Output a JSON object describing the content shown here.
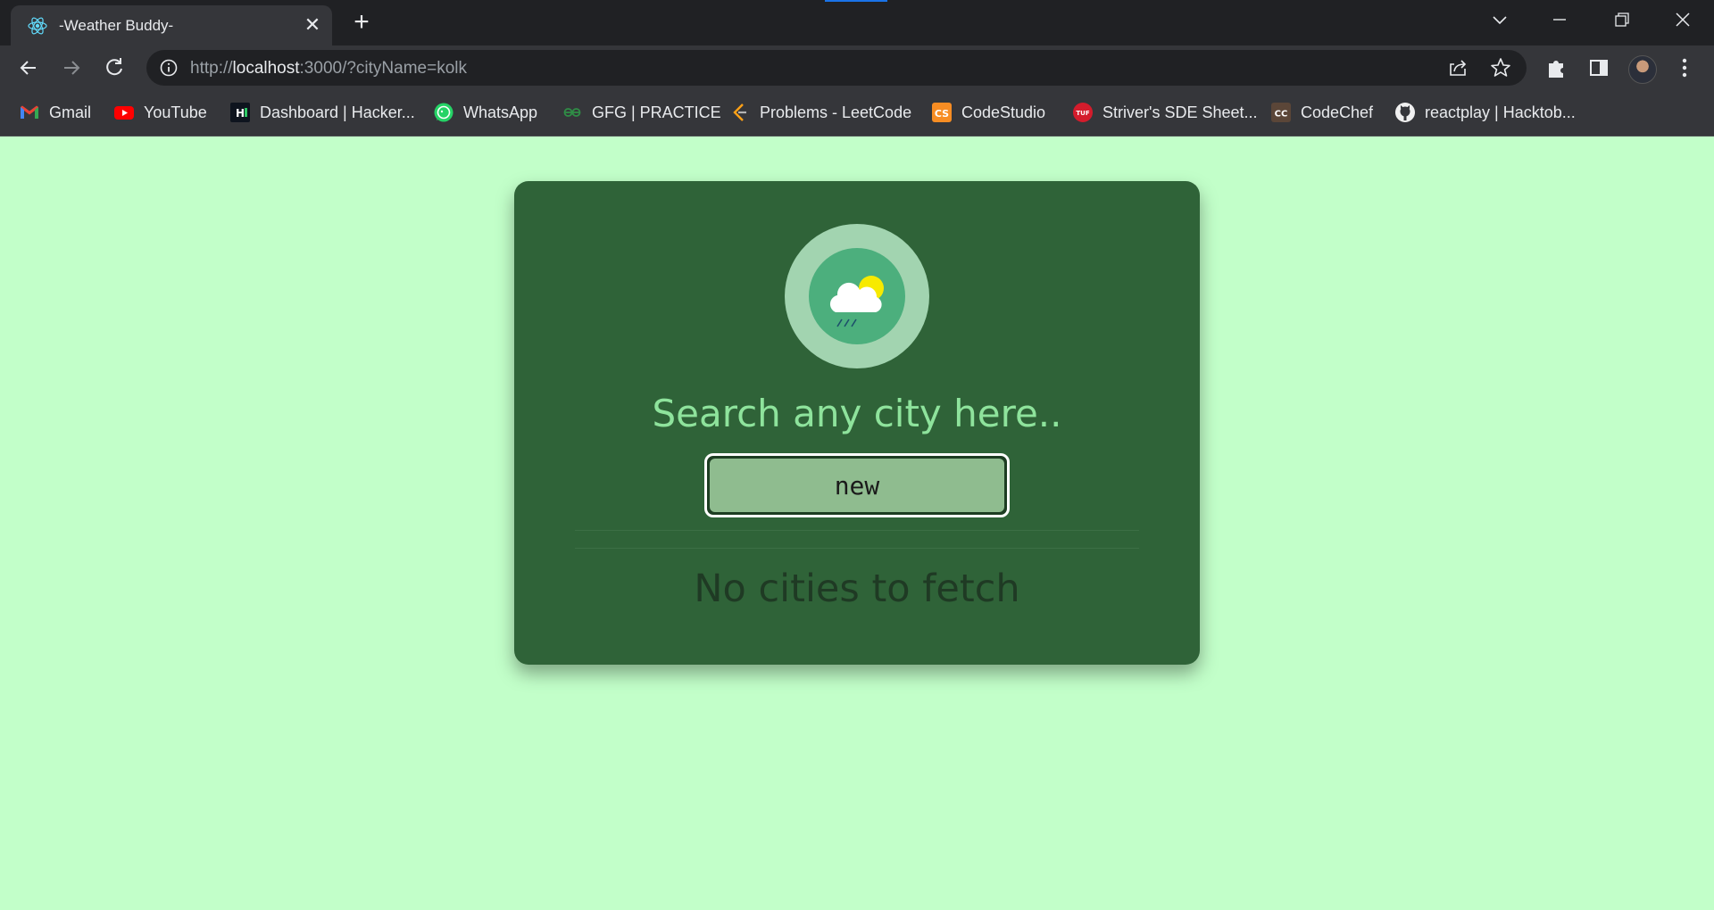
{
  "browser": {
    "tab": {
      "title": "-Weather Buddy-",
      "favicon": "react-icon"
    },
    "address_bar": {
      "url_prefix": "http://",
      "url_host": "localhost",
      "url_rest": ":3000/?cityName=kolk"
    },
    "bookmarks": [
      {
        "label": "Gmail",
        "icon": "gmail-icon"
      },
      {
        "label": "YouTube",
        "icon": "youtube-icon"
      },
      {
        "label": "Dashboard | Hacker...",
        "icon": "hackerrank-icon"
      },
      {
        "label": "WhatsApp",
        "icon": "whatsapp-icon"
      },
      {
        "label": "GFG | PRACTICE",
        "icon": "geeksforgeeks-icon"
      },
      {
        "label": "Problems - LeetCode",
        "icon": "leetcode-icon"
      },
      {
        "label": "CodeStudio",
        "icon": "codestudio-icon"
      },
      {
        "label": "Striver's SDE Sheet...",
        "icon": "tuf-icon"
      },
      {
        "label": "CodeChef",
        "icon": "codechef-icon"
      },
      {
        "label": "reactplay | Hacktob...",
        "icon": "github-icon"
      }
    ]
  },
  "app": {
    "heading": "Search any city here..",
    "search": {
      "value": "new"
    },
    "empty_message": "No cities to fetch",
    "colors": {
      "page_background": "#c2ffc9",
      "card_background": "#2f6338",
      "heading": "#8ee39c",
      "input_background": "#8fbc8f"
    }
  }
}
